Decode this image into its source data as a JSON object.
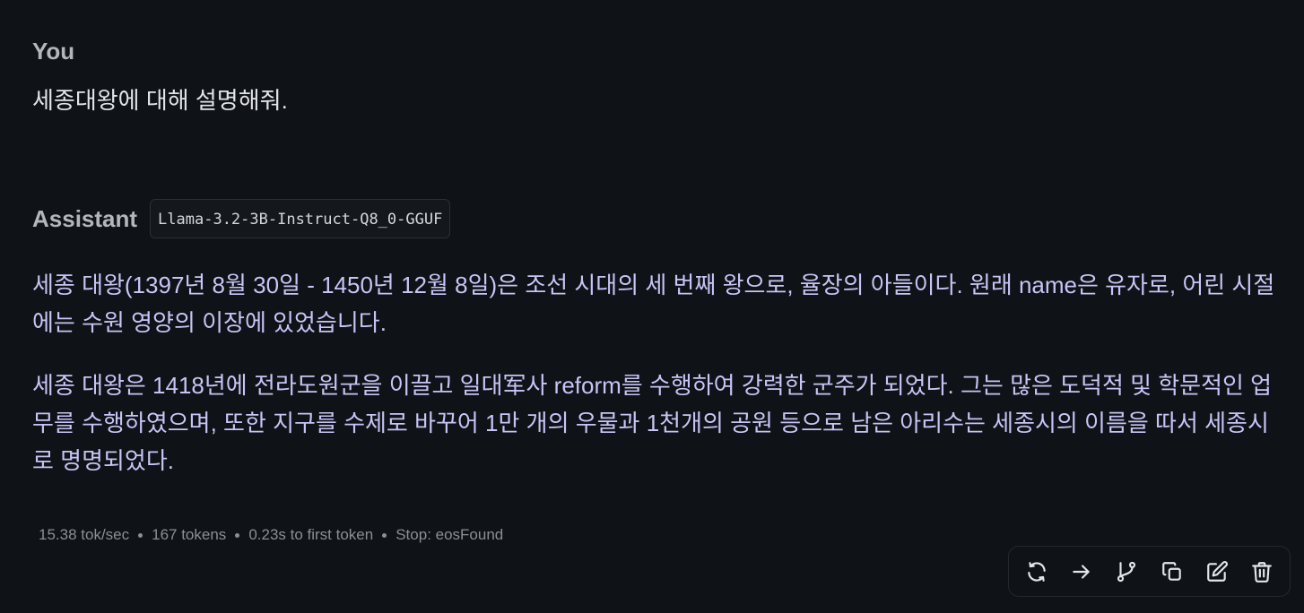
{
  "user": {
    "label": "You",
    "message": "세종대왕에 대해 설명해줘."
  },
  "assistant": {
    "label": "Assistant",
    "model": "Llama-3.2-3B-Instruct-Q8_0-GGUF",
    "paragraphs": [
      "세종 대왕(1397년 8월 30일 - 1450년 12월 8일)은 조선 시대의 세 번째 왕으로, 율장의 아들이다. 원래 name은 유자로, 어린 시절에는 수원 영양의 이장에 있었습니다.",
      "세종 대왕은 1418년에 전라도원군을 이끌고 일대军사 reform를 수행하여 강력한 군주가 되었다. 그는 많은 도덕적 및 학문적인 업무를 수행하였으며, 또한 지구를 수제로 바꾸어 1만 개의 우물과 1천개의 공원 등으로 남은 아리수는 세종시의 이름을 따서 세종시로 명명되었다."
    ]
  },
  "stats": {
    "speed": "15.38 tok/sec",
    "tokens": "167 tokens",
    "first_token": "0.23s to first token",
    "stop": "Stop: eosFound"
  },
  "toolbar": {
    "icons": [
      "regenerate-icon",
      "continue-icon",
      "branch-icon",
      "copy-icon",
      "edit-icon",
      "delete-icon"
    ]
  },
  "colors": {
    "background": "#0f1216",
    "assistant_text": "#c9c4f6",
    "user_text": "#e3e4e7",
    "muted": "#8b8f96"
  }
}
